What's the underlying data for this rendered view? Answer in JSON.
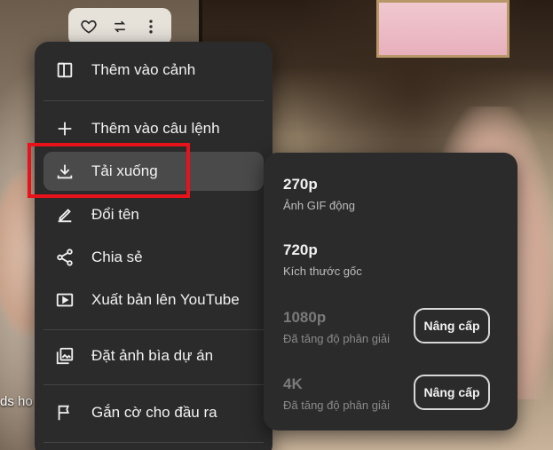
{
  "background": {
    "left_partial_text": "ds ho"
  },
  "clip_actions": {
    "icons": [
      "heart-icon",
      "swap-icon",
      "more-vert-icon"
    ]
  },
  "menu": {
    "items": [
      {
        "label": "Thêm vào cảnh",
        "icon": "split-panel-icon"
      },
      {
        "label": "Thêm vào câu lệnh",
        "icon": "plus-icon"
      },
      {
        "label": "Tải xuống",
        "icon": "download-icon",
        "active": true
      },
      {
        "label": "Đổi tên",
        "icon": "pencil-icon"
      },
      {
        "label": "Chia sẻ",
        "icon": "share-icon"
      },
      {
        "label": "Xuất bản lên YouTube",
        "icon": "youtube-play-icon"
      },
      {
        "label": "Đặt ảnh bìa dự án",
        "icon": "image-stack-icon"
      },
      {
        "label": "Gắn cờ cho đầu ra",
        "icon": "flag-icon"
      }
    ],
    "highlight_color": "#e8121a"
  },
  "download_submenu": {
    "options": [
      {
        "resolution": "270p",
        "description": "Ảnh GIF động",
        "enabled": true
      },
      {
        "resolution": "720p",
        "description": "Kích thước gốc",
        "enabled": true
      },
      {
        "resolution": "1080p",
        "description": "Đã tăng độ phân giải",
        "enabled": false,
        "button": "Nâng cấp"
      },
      {
        "resolution": "4K",
        "description": "Đã tăng độ phân giải",
        "enabled": false,
        "button": "Nâng cấp"
      }
    ]
  }
}
